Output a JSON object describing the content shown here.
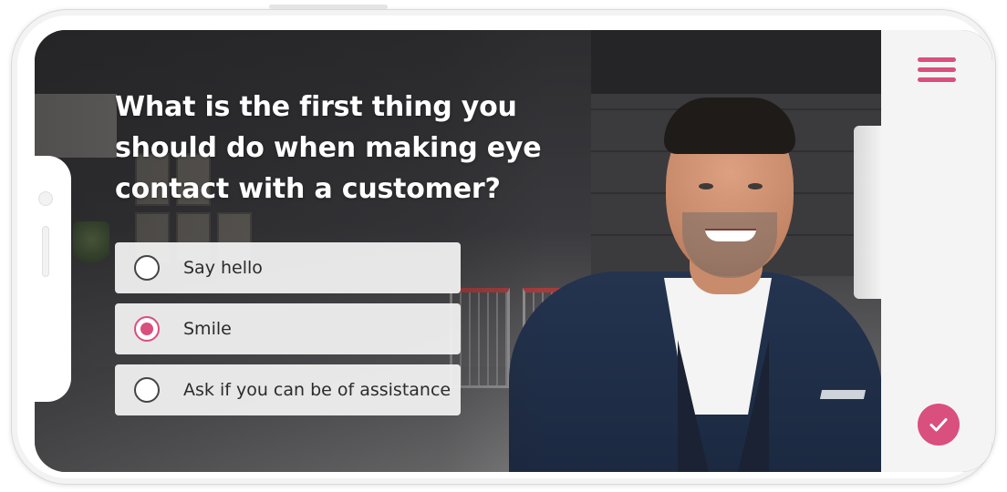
{
  "question": {
    "text": "What is the first thing you should do when making eye contact with a customer?"
  },
  "options": [
    {
      "label": "Say hello",
      "selected": false
    },
    {
      "label": "Smile",
      "selected": true
    },
    {
      "label": "Ask if you can be of assistance",
      "selected": false
    }
  ],
  "sidebar": {
    "menu_icon": "hamburger-menu-icon",
    "submit_icon": "checkmark-icon"
  },
  "colors": {
    "accent": "#d94f7d",
    "option_background": "#f0f0f0",
    "sidebar_background": "#f4f4f4"
  }
}
